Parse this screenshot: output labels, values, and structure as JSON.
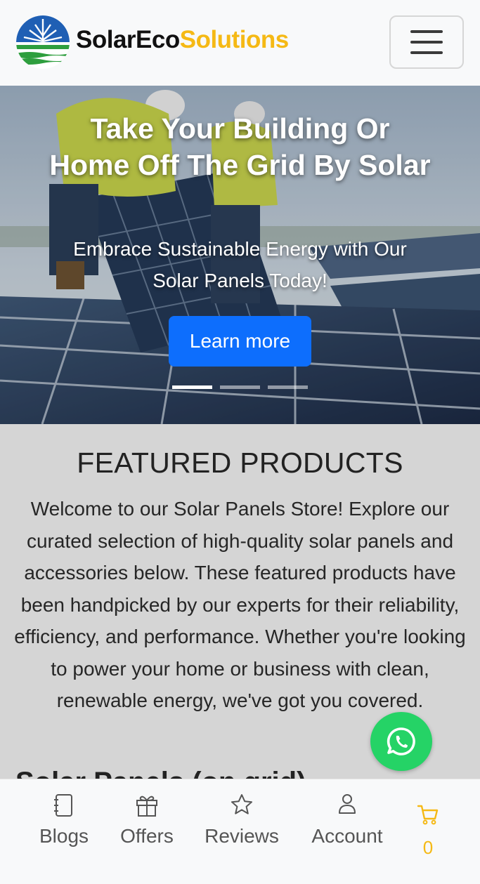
{
  "header": {
    "brand_part1": "SolarEco",
    "brand_part2": "Solutions",
    "logo_icon": "solar-leaf-logo",
    "menu_icon": "hamburger-icon"
  },
  "hero": {
    "title": "Take Your Building Or Home Off The Grid By Solar",
    "subtitle": "Embrace Sustainable Energy with Our Solar Panels Today!",
    "button_label": "Learn more",
    "slides_total": 3,
    "active_slide": 1
  },
  "featured": {
    "title": "FEATURED PRODUCTS",
    "description": "Welcome to our Solar Panels Store! Explore our curated selection of high-quality solar panels and accessories below. These featured products have been handpicked by our experts for their reliability, efficiency, and performance. Whether you're looking to power your home or business with clean, renewable energy, we've got you covered.",
    "next_heading": "Solar Panels (on grid)"
  },
  "whatsapp": {
    "icon": "whatsapp-icon"
  },
  "bottom_nav": {
    "items": [
      {
        "label": "Blogs",
        "icon": "notebook-icon"
      },
      {
        "label": "Offers",
        "icon": "gift-icon"
      },
      {
        "label": "Reviews",
        "icon": "star-icon"
      },
      {
        "label": "Account",
        "icon": "person-icon"
      }
    ],
    "cart": {
      "icon": "cart-icon",
      "count": "0"
    }
  },
  "colors": {
    "brand_dark": "#111111",
    "brand_accent": "#f5b915",
    "primary_button": "#0d6efd",
    "whatsapp_green": "#25d366",
    "section_bg": "#d5d5d5"
  }
}
